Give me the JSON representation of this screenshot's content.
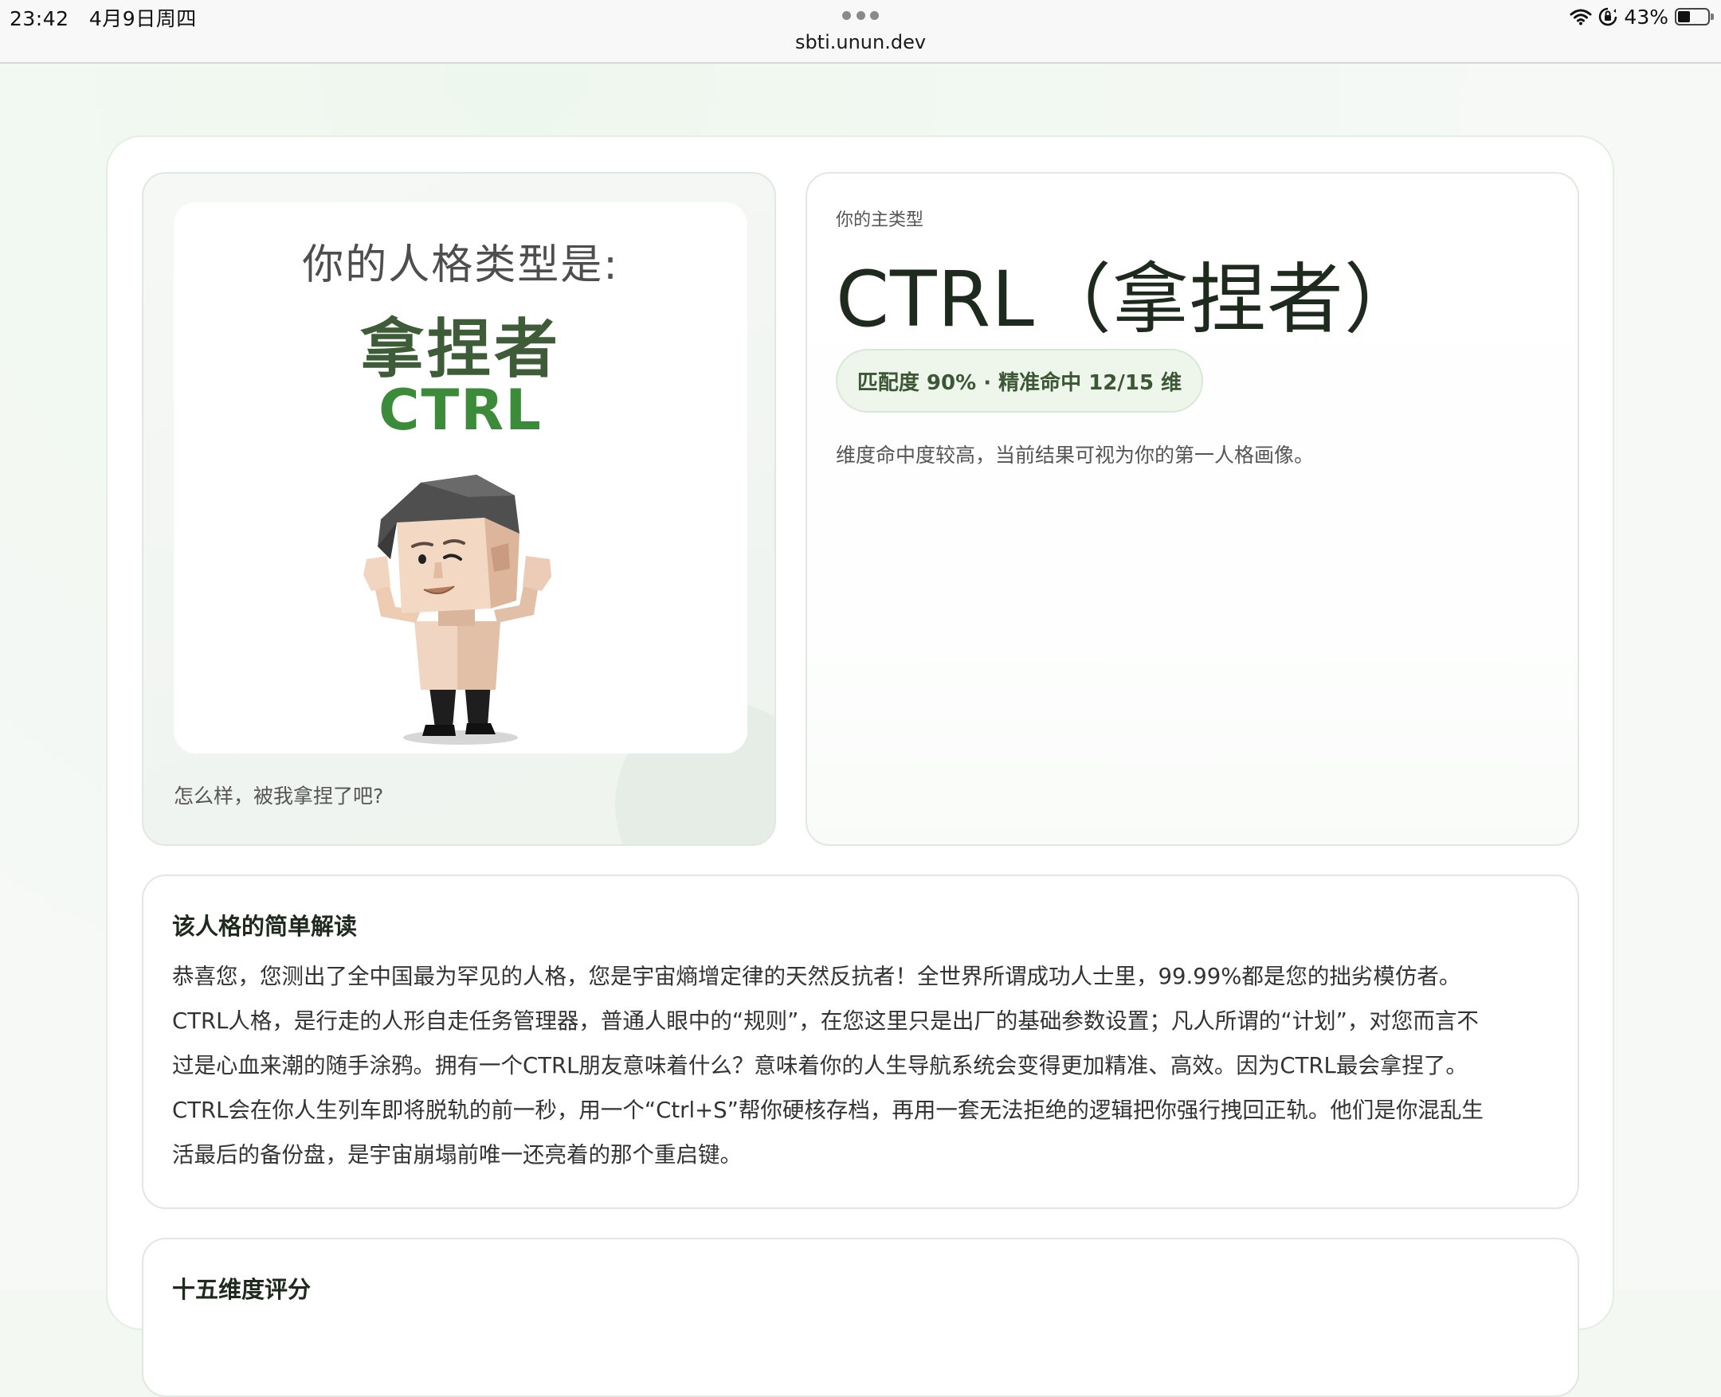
{
  "status_bar": {
    "time": "23:42",
    "date": "4月9日周四",
    "url": "sbti.unun.dev",
    "battery": "43%",
    "battery_level": 0.43,
    "icons": [
      "more-dots-icon",
      "wifi-icon",
      "orientation-lock-icon",
      "battery-icon"
    ]
  },
  "poster": {
    "heading": "你的人格类型是:",
    "name": "拿捏者",
    "code": "CTRL",
    "caption": "怎么样，被我拿捏了吧?",
    "image": "cartoon-man-flexing-illustration"
  },
  "result": {
    "eyebrow": "你的主类型",
    "title": "CTRL（拿捏者）",
    "match_pill": "匹配度 90% · 精准命中 12/15 维",
    "note": "维度命中度较高，当前结果可视为你的第一人格画像。"
  },
  "description": {
    "title": "该人格的简单解读",
    "lines": [
      "恭喜您，您测出了全中国最为罕见的人格，您是宇宙熵增定律的天然反抗者！全世界所谓成功人士里，99.99%都是您的拙劣模仿者。",
      "CTRL人格，是行走的人形自走任务管理器，普通人眼中的“规则”，在您这里只是出厂的基础参数设置；凡人所谓的“计划”，对您而言不",
      "过是心血来潮的随手涂鸦。拥有一个CTRL朋友意味着什么？意味着你的人生导航系统会变得更加精准、高效。因为CTRL最会拿捏了。",
      "CTRL会在你人生列车即将脱轨的前一秒，用一个“Ctrl+S”帮你硬核存档，再用一套无法拒绝的逻辑把你强行拽回正轨。他们是你混乱生",
      "活最后的备份盘，是宇宙崩塌前唯一还亮着的那个重启键。"
    ]
  },
  "dimensions": {
    "title": "十五维度评分"
  },
  "colors": {
    "accent_green": "#3b8b3b",
    "name_green": "#3f5c38",
    "pill_bg": "#eef6ec"
  }
}
